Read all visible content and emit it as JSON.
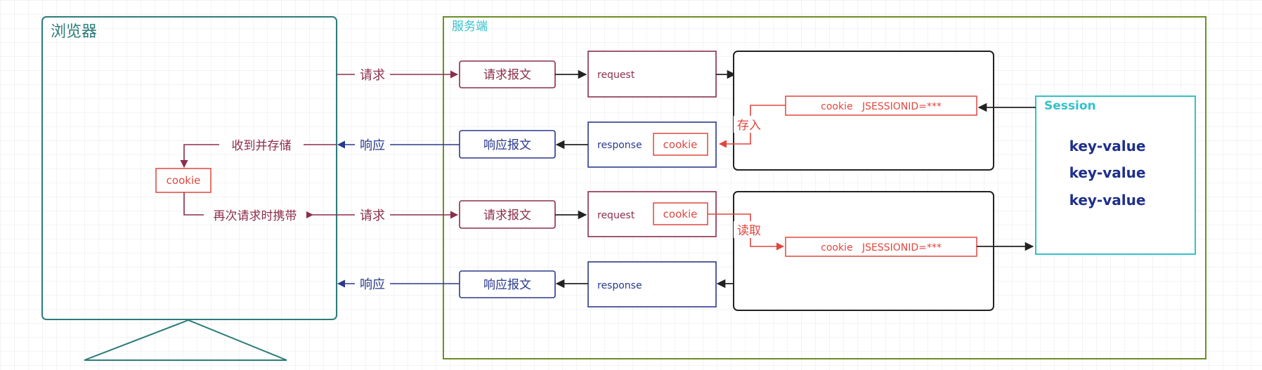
{
  "browser": {
    "title": "浏览器",
    "cookie_label": "cookie",
    "received_store_label": "收到并存储",
    "resend_label": "再次请求时携带"
  },
  "server": {
    "title": "服务端",
    "flow1": {
      "request_label": "请求",
      "request_message": "请求报文",
      "request_obj": "request",
      "response_label": "响应",
      "response_message": "响应报文",
      "response_obj": "response",
      "response_cookie": "cookie",
      "store_label": "存入",
      "cookie_entry": "cookie   JSESSIONID=***"
    },
    "flow2": {
      "request_label": "请求",
      "request_message": "请求报文",
      "request_obj": "request",
      "request_cookie": "cookie",
      "response_label": "响应",
      "response_message": "响应报文",
      "response_obj": "response",
      "read_label": "读取",
      "cookie_entry": "cookie   JSESSIONID=***"
    },
    "session": {
      "title": "Session",
      "entries": [
        "key-value",
        "key-value",
        "key-value"
      ]
    }
  },
  "colors": {
    "browser_border": "#2c7c7a",
    "server_border": "#6b8e23",
    "request_red": "#8b2e4a",
    "response_blue": "#2a3a8c",
    "cookie_red": "#e0463e",
    "session_teal": "#34c1cc",
    "kv_navy": "#1e2f8c",
    "black": "#222222"
  }
}
